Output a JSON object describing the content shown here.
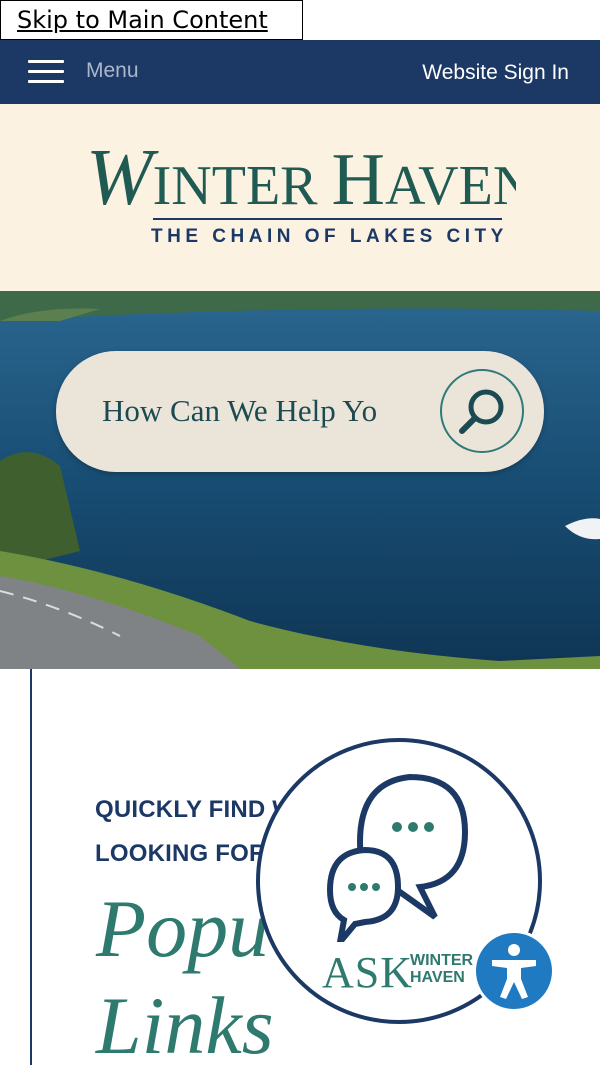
{
  "skip_link": "Skip to Main Content",
  "topbar": {
    "menu_label": "Menu",
    "sign_in": "Website Sign In"
  },
  "logo": {
    "name": "WINTER HAVEN",
    "tagline": "THE CHAIN OF LAKES CITY"
  },
  "search": {
    "placeholder": "How Can We Help Yo"
  },
  "content": {
    "kicker_line1": "QUICKLY FIND W",
    "kicker_line2": "LOOKING FOR",
    "title_line1": "Popu",
    "title_line2": "Links"
  },
  "ask_widget": {
    "label": "ASK",
    "sub_line1": "WINTER",
    "sub_line2": "HAVEN"
  },
  "colors": {
    "navy": "#1c3966",
    "teal": "#2f7a6e",
    "cream": "#fbf2e2",
    "accessibility_blue": "#1f7ac2"
  },
  "icons": [
    "menu-icon",
    "search-icon",
    "chat-bubbles-icon",
    "accessibility-icon"
  ]
}
